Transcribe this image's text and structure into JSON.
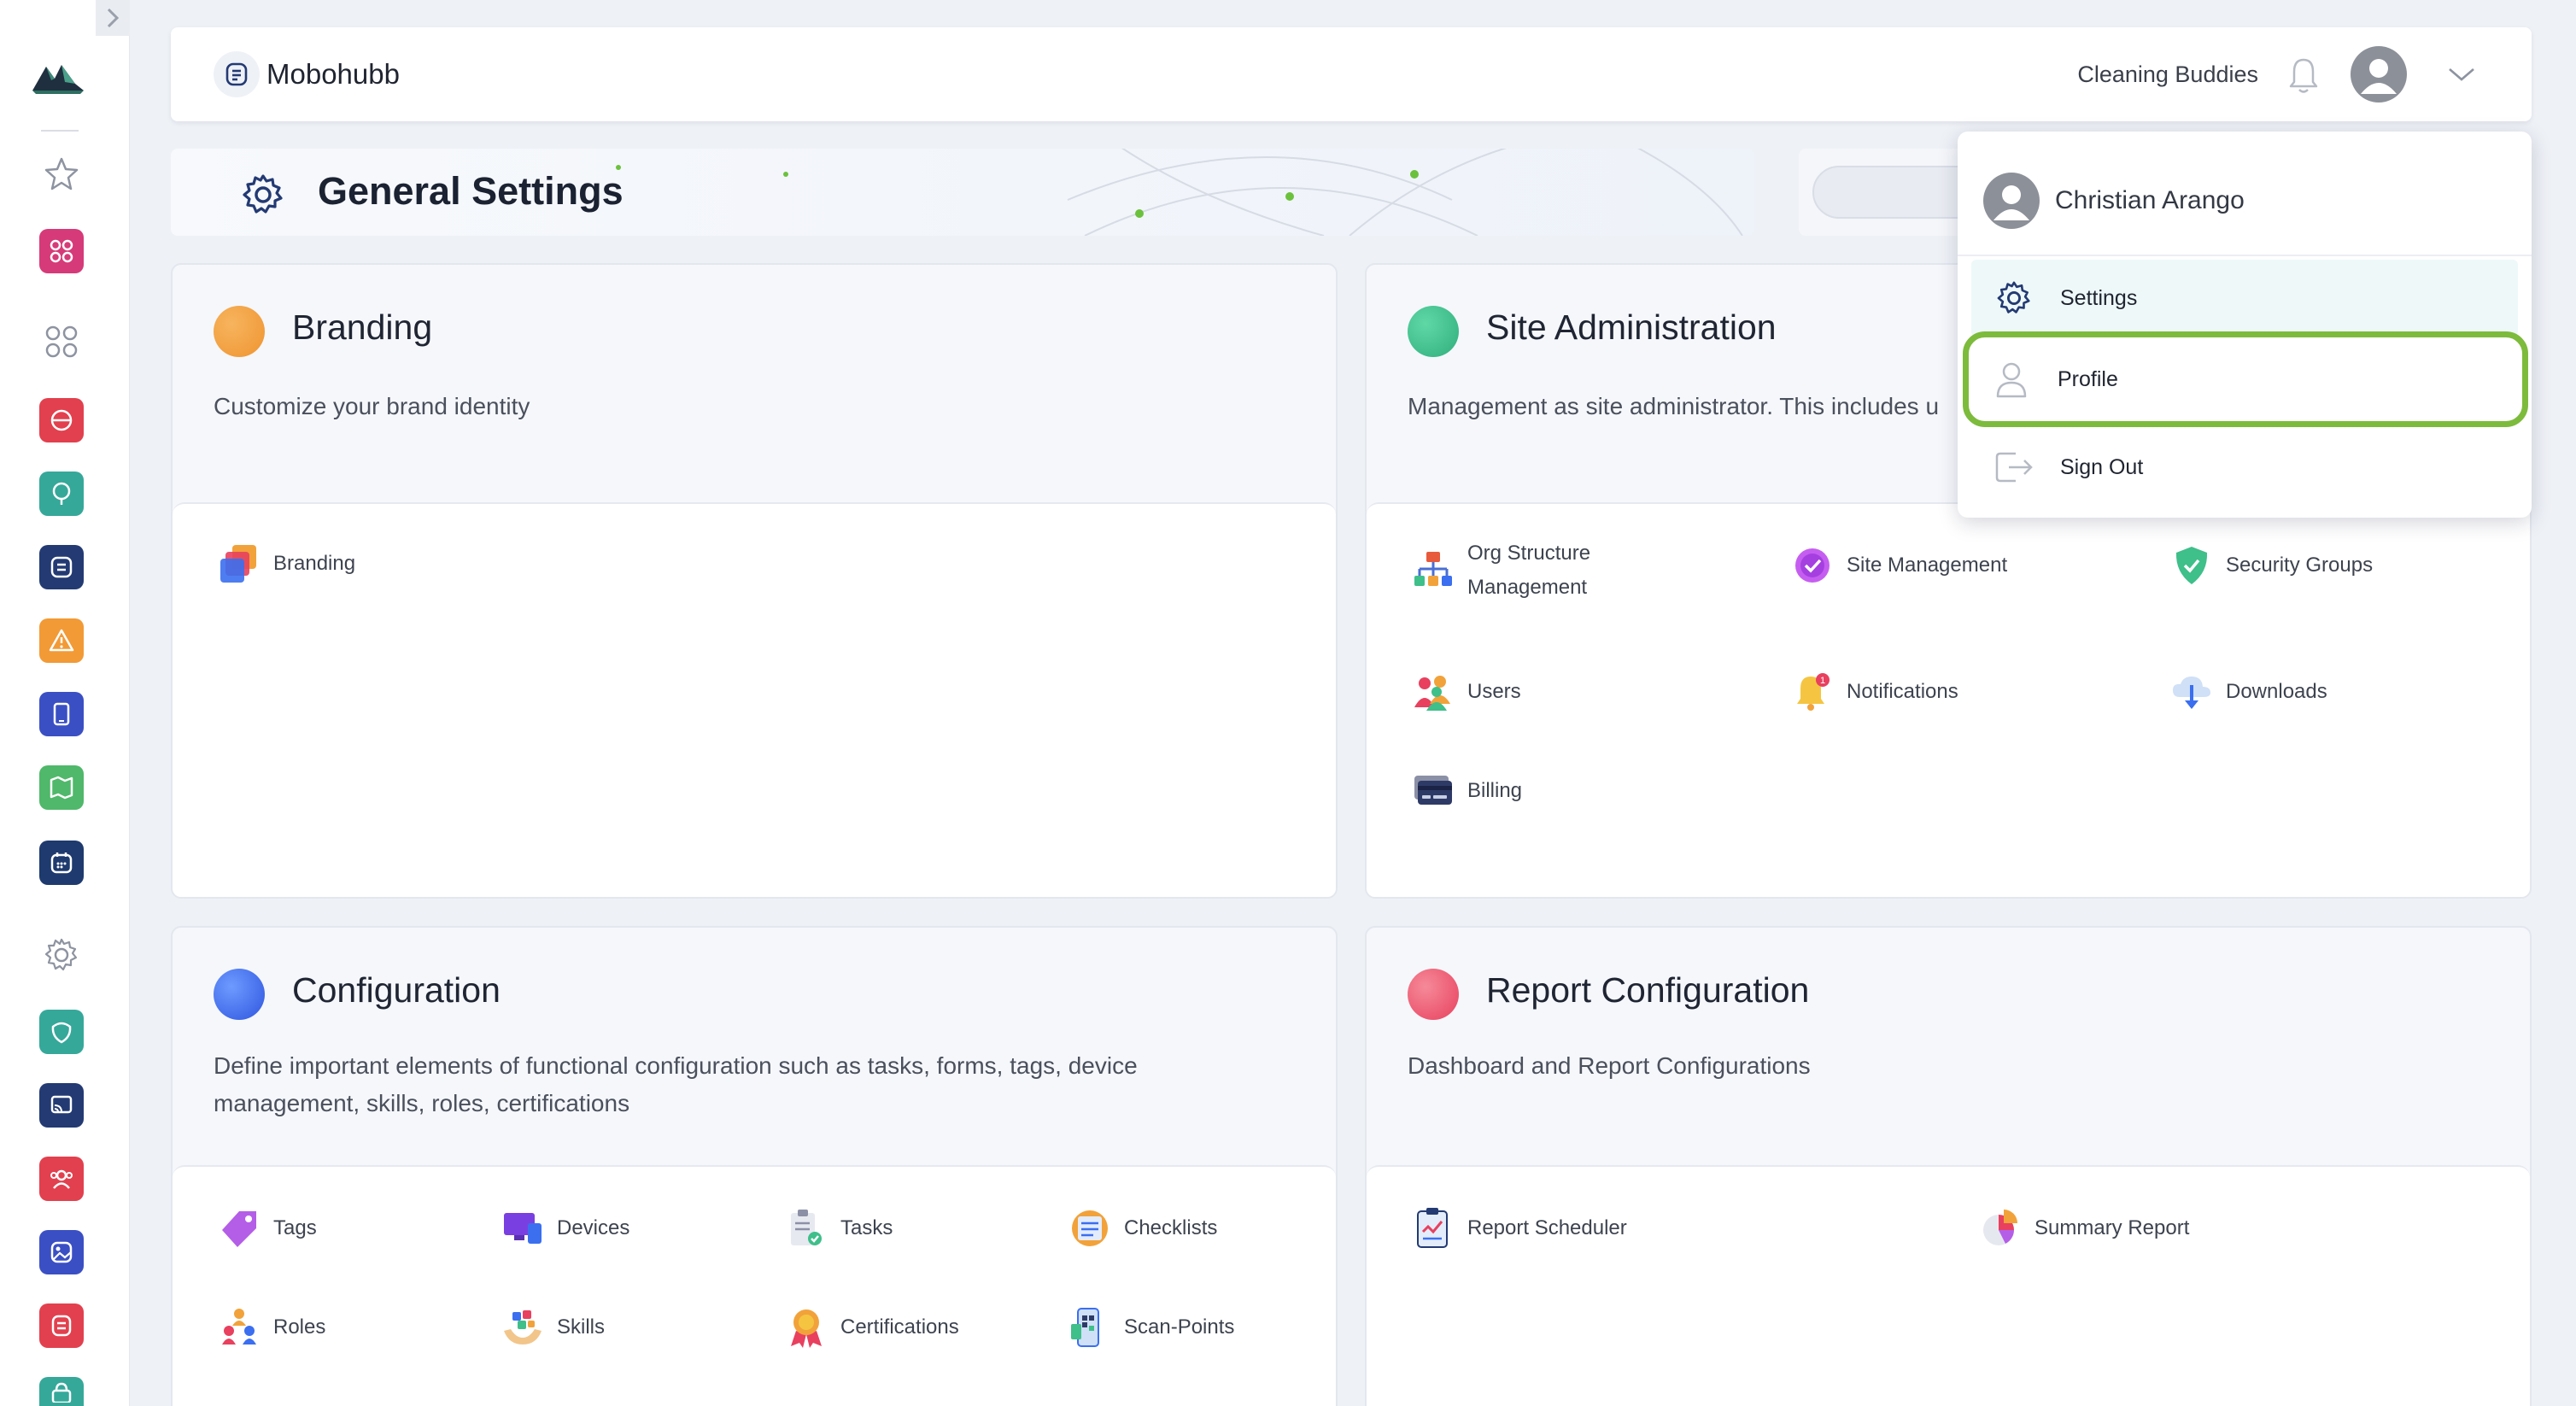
{
  "header": {
    "brand_name": "Mobohubb",
    "org_name": "Cleaning Buddies"
  },
  "page": {
    "title": "General Settings"
  },
  "cards": {
    "branding": {
      "title": "Branding",
      "description": "Customize your brand identity",
      "items": [
        "Branding"
      ]
    },
    "site_admin": {
      "title": "Site Administration",
      "description": "Management as site administrator. This includes u",
      "items": [
        "Org Structure Management",
        "Site Management",
        "Security Groups",
        "Users",
        "Notifications",
        "Downloads",
        "Billing"
      ]
    },
    "configuration": {
      "title": "Configuration",
      "description": "Define important elements of functional configuration such as tasks, forms, tags, device management, skills, roles, certifications",
      "items": [
        "Tags",
        "Devices",
        "Tasks",
        "Checklists",
        "Roles",
        "Skills",
        "Certifications",
        "Scan-Points"
      ]
    },
    "report_config": {
      "title": "Report Configuration",
      "description": "Dashboard and Report Configurations",
      "items": [
        "Report Scheduler",
        "Summary Report"
      ]
    }
  },
  "dropdown": {
    "user_name": "Christian Arango",
    "items": [
      "Settings",
      "Profile",
      "Sign Out"
    ]
  },
  "colors": {
    "branding_dot": "#f0a043",
    "site_admin_dot": "#3fbf8a",
    "configuration_dot": "#3b6ff0",
    "report_dot": "#ee5a6e",
    "focus_ring": "#7dbb3c",
    "accent_navy": "#233a73"
  }
}
